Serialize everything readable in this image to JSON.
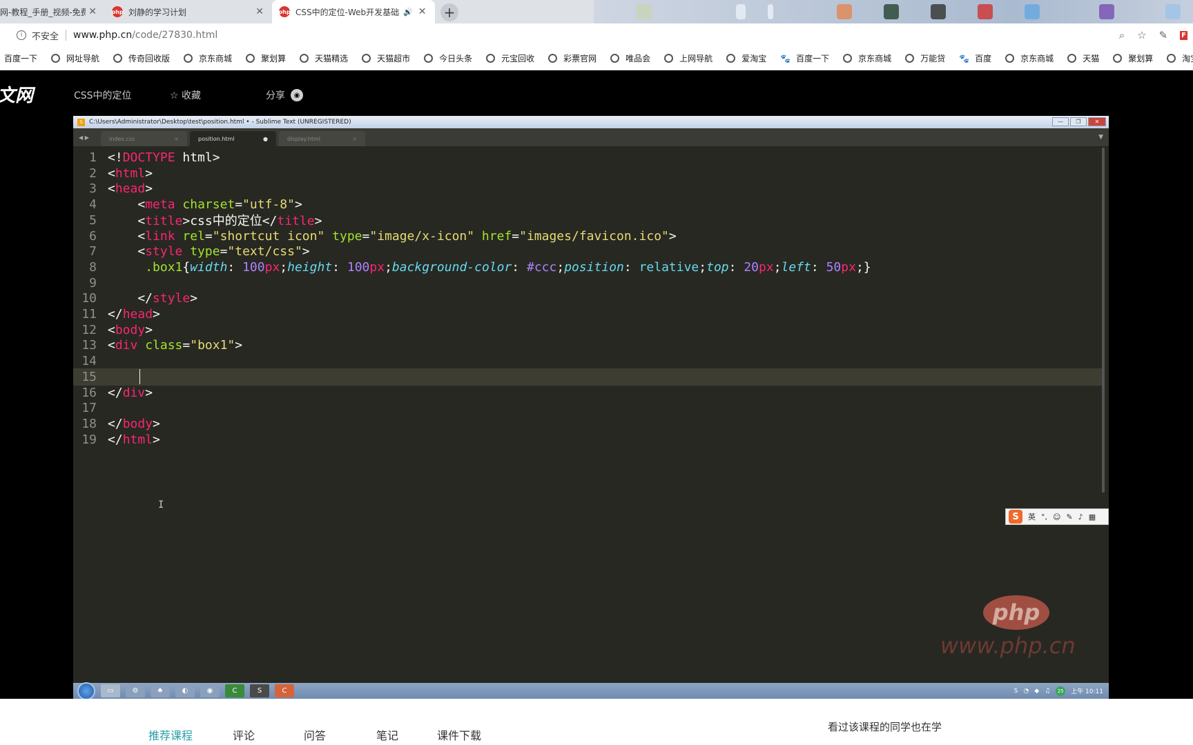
{
  "browser": {
    "tabs": [
      {
        "label": "网-教程_手册_视频-免费",
        "active": false
      },
      {
        "label": "刘静的学习计划",
        "active": false
      },
      {
        "label": "CSS中的定位-Web开发基础",
        "active": true
      }
    ],
    "tab_favicon_text": "php",
    "insecure_label": "不安全",
    "url_host": "www.php.cn",
    "url_path": "/code/27830.html",
    "bookmarks": [
      {
        "label": "百度一下",
        "icon": "none"
      },
      {
        "label": "网址导航",
        "icon": "globe"
      },
      {
        "label": "传奇回收版",
        "icon": "globe"
      },
      {
        "label": "京东商城",
        "icon": "globe"
      },
      {
        "label": "聚划算",
        "icon": "globe"
      },
      {
        "label": "天猫精选",
        "icon": "globe"
      },
      {
        "label": "天猫超市",
        "icon": "globe"
      },
      {
        "label": "今日头条",
        "icon": "globe"
      },
      {
        "label": "元宝回收",
        "icon": "globe"
      },
      {
        "label": "彩票官网",
        "icon": "globe"
      },
      {
        "label": "唯品会",
        "icon": "globe"
      },
      {
        "label": "上网导航",
        "icon": "globe"
      },
      {
        "label": "爱淘宝",
        "icon": "globe"
      },
      {
        "label": "百度一下",
        "icon": "paw"
      },
      {
        "label": "京东商城",
        "icon": "globe"
      },
      {
        "label": "万能贷",
        "icon": "globe"
      },
      {
        "label": "百度",
        "icon": "paw"
      },
      {
        "label": "京东商城",
        "icon": "globe"
      },
      {
        "label": "天猫",
        "icon": "globe"
      },
      {
        "label": "聚划算",
        "icon": "globe"
      },
      {
        "label": "淘宝优惠券",
        "icon": "globe"
      }
    ]
  },
  "page": {
    "logo": "文网",
    "breadcrumb": "CSS中的定位",
    "favorite_label": "收藏",
    "share_label": "分享"
  },
  "sublime": {
    "title": "C:\\Users\\Administrator\\Desktop\\test\\position.html • - Sublime Text (UNREGISTERED)",
    "tabs": [
      {
        "label": "index.css",
        "active": false,
        "mark": "×"
      },
      {
        "label": "position.html",
        "active": true,
        "mark": "●"
      },
      {
        "label": "display.html",
        "active": false,
        "mark": "×"
      }
    ],
    "line_numbers": [
      "1",
      "2",
      "3",
      "4",
      "5",
      "6",
      "7",
      "8",
      "9",
      "10",
      "11",
      "12",
      "13",
      "14",
      "15",
      "16",
      "17",
      "18",
      "19"
    ],
    "current_line": 15
  },
  "ime": {
    "lang": "英"
  },
  "watermark": {
    "logo": "php",
    "url": "www.php.cn"
  },
  "taskbar": {
    "time": "上午 10:11",
    "badge": "25"
  },
  "bottom": {
    "tabs": [
      {
        "label": "推荐课程",
        "active": true
      },
      {
        "label": "评论",
        "active": false
      },
      {
        "label": "问答",
        "active": false
      },
      {
        "label": "笔记",
        "active": false
      },
      {
        "label": "课件下载",
        "active": false
      }
    ],
    "also_learning": "看过该课程的同学也在学"
  }
}
